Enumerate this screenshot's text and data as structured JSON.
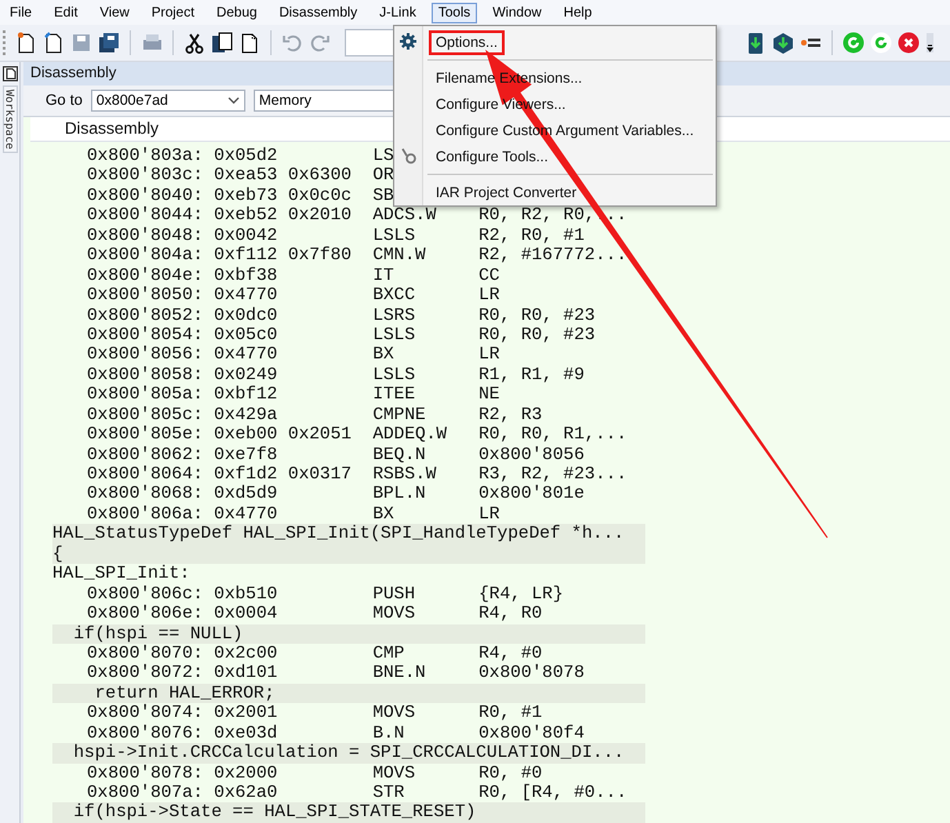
{
  "menubar": [
    {
      "label": "File",
      "selected": false
    },
    {
      "label": "Edit",
      "selected": false
    },
    {
      "label": "View",
      "selected": false
    },
    {
      "label": "Project",
      "selected": false
    },
    {
      "label": "Debug",
      "selected": false
    },
    {
      "label": "Disassembly",
      "selected": false
    },
    {
      "label": "J-Link",
      "selected": false
    },
    {
      "label": "Tools",
      "selected": true
    },
    {
      "label": "Window",
      "selected": false
    },
    {
      "label": "Help",
      "selected": false
    }
  ],
  "sidebar": {
    "tab": "Workspace"
  },
  "panel": {
    "title": "Disassembly",
    "goto_label": "Go to",
    "goto_value": "0x800e7ad",
    "memory": "Memory",
    "column": "Disassembly"
  },
  "rows": [
    {
      "kind": "instr",
      "addr": "0x800'803a:",
      "bytes": "0x05d2",
      "mnemonic": "LS"
    },
    {
      "kind": "instr",
      "addr": "0x800'803c:",
      "bytes": "0xea53 0x6300",
      "mnemonic": "OR"
    },
    {
      "kind": "instr",
      "addr": "0x800'8040:",
      "bytes": "0xeb73 0x0c0c",
      "mnemonic": "SB"
    },
    {
      "kind": "instr",
      "addr": "0x800'8044:",
      "bytes": "0xeb52 0x2010",
      "mnemonic": "ADCS.W",
      "operands": "R0, R2, R0,..."
    },
    {
      "kind": "instr",
      "addr": "0x800'8048:",
      "bytes": "0x0042",
      "mnemonic": "LSLS",
      "operands": "R2, R0, #1"
    },
    {
      "kind": "instr",
      "addr": "0x800'804a:",
      "bytes": "0xf112 0x7f80",
      "mnemonic": "CMN.W",
      "operands": "R2, #167772..."
    },
    {
      "kind": "instr",
      "addr": "0x800'804e:",
      "bytes": "0xbf38",
      "mnemonic": "IT",
      "operands": "CC"
    },
    {
      "kind": "instr",
      "addr": "0x800'8050:",
      "bytes": "0x4770",
      "mnemonic": "BXCC",
      "operands": "LR"
    },
    {
      "kind": "instr",
      "addr": "0x800'8052:",
      "bytes": "0x0dc0",
      "mnemonic": "LSRS",
      "operands": "R0, R0, #23"
    },
    {
      "kind": "instr",
      "addr": "0x800'8054:",
      "bytes": "0x05c0",
      "mnemonic": "LSLS",
      "operands": "R0, R0, #23"
    },
    {
      "kind": "instr",
      "addr": "0x800'8056:",
      "bytes": "0x4770",
      "mnemonic": "BX",
      "operands": "LR"
    },
    {
      "kind": "instr",
      "addr": "0x800'8058:",
      "bytes": "0x0249",
      "mnemonic": "LSLS",
      "operands": "R1, R1, #9"
    },
    {
      "kind": "instr",
      "addr": "0x800'805a:",
      "bytes": "0xbf12",
      "mnemonic": "ITEE",
      "operands": "NE"
    },
    {
      "kind": "instr",
      "addr": "0x800'805c:",
      "bytes": "0x429a",
      "mnemonic": "CMPNE",
      "operands": "R2, R3"
    },
    {
      "kind": "instr",
      "addr": "0x800'805e:",
      "bytes": "0xeb00 0x2051",
      "mnemonic": "ADDEQ.W",
      "operands": "R0, R0, R1,..."
    },
    {
      "kind": "instr",
      "addr": "0x800'8062:",
      "bytes": "0xe7f8",
      "mnemonic": "BEQ.N",
      "operands": "0x800'8056"
    },
    {
      "kind": "instr",
      "addr": "0x800'8064:",
      "bytes": "0xf1d2 0x0317",
      "mnemonic": "RSBS.W",
      "operands": "R3, R2, #23..."
    },
    {
      "kind": "instr",
      "addr": "0x800'8068:",
      "bytes": "0xd5d9",
      "mnemonic": "BPL.N",
      "operands": "0x800'801e"
    },
    {
      "kind": "instr",
      "addr": "0x800'806a:",
      "bytes": "0x4770",
      "mnemonic": "BX",
      "operands": "LR"
    },
    {
      "kind": "source",
      "text": "HAL_StatusTypeDef HAL_SPI_Init(SPI_HandleTypeDef *h..."
    },
    {
      "kind": "source",
      "text": "{"
    },
    {
      "kind": "label",
      "text": "HAL_SPI_Init:"
    },
    {
      "kind": "instr",
      "addr": "0x800'806c:",
      "bytes": "0xb510",
      "mnemonic": "PUSH",
      "operands": "{R4, LR}"
    },
    {
      "kind": "instr",
      "addr": "0x800'806e:",
      "bytes": "0x0004",
      "mnemonic": "MOVS",
      "operands": "R4, R0"
    },
    {
      "kind": "source",
      "text": "  if(hspi == NULL)"
    },
    {
      "kind": "instr",
      "addr": "0x800'8070:",
      "bytes": "0x2c00",
      "mnemonic": "CMP",
      "operands": "R4, #0"
    },
    {
      "kind": "instr",
      "addr": "0x800'8072:",
      "bytes": "0xd101",
      "mnemonic": "BNE.N",
      "operands": "0x800'8078"
    },
    {
      "kind": "source",
      "text": "    return HAL_ERROR;"
    },
    {
      "kind": "instr",
      "addr": "0x800'8074:",
      "bytes": "0x2001",
      "mnemonic": "MOVS",
      "operands": "R0, #1"
    },
    {
      "kind": "instr",
      "addr": "0x800'8076:",
      "bytes": "0xe03d",
      "mnemonic": "B.N",
      "operands": "0x800'80f4"
    },
    {
      "kind": "source",
      "text": "  hspi->Init.CRCCalculation = SPI_CRCCALCULATION_DI..."
    },
    {
      "kind": "instr",
      "addr": "0x800'8078:",
      "bytes": "0x2000",
      "mnemonic": "MOVS",
      "operands": "R0, #0"
    },
    {
      "kind": "instr",
      "addr": "0x800'807a:",
      "bytes": "0x62a0",
      "mnemonic": "STR",
      "operands": "R0, [R4, #0..."
    },
    {
      "kind": "source",
      "text": "  if(hspi->State == HAL_SPI_STATE_RESET)"
    }
  ],
  "tools_menu": {
    "groups": [
      [
        {
          "label": "Options...",
          "kind": "settings",
          "boxed": true
        }
      ],
      [
        {
          "label": "Filename Extensions...",
          "kind": "plain",
          "boxed": false
        },
        {
          "label": "Configure Viewers...",
          "kind": "plain",
          "boxed": false
        },
        {
          "label": "Configure Custom Argument Variables...",
          "kind": "plain",
          "boxed": false
        },
        {
          "label": "Configure Tools...",
          "kind": "tools",
          "boxed": false
        }
      ],
      [
        {
          "label": "IAR Project Converter",
          "kind": "plain",
          "boxed": false
        }
      ]
    ]
  }
}
